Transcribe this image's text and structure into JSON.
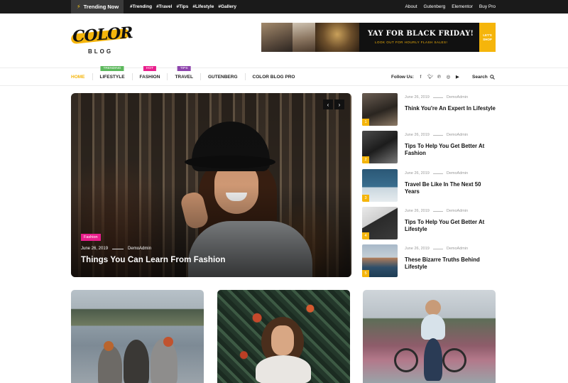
{
  "topbar": {
    "trending_label": "Trending Now",
    "tags": [
      "#Trending",
      "#Travel",
      "#Tips",
      "#Lifestyle",
      "#Gallery"
    ],
    "links": [
      "About",
      "Gutenberg",
      "Elementor",
      "Buy Pro"
    ]
  },
  "logo": {
    "word": "COLOR",
    "sub": "BLOG"
  },
  "banner": {
    "title": "YAY FOR BLACK FRIDAY!",
    "subtitle": "LOOK OUT FOR HOURLY FLASH SALES!",
    "cta": "LET'S SHOP"
  },
  "nav": {
    "items": [
      {
        "label": "HOME",
        "badge": ""
      },
      {
        "label": "LIFESTYLE",
        "badge": "TRENDING"
      },
      {
        "label": "FASHION",
        "badge": "HOT"
      },
      {
        "label": "TRAVEL",
        "badge": "TIPS"
      },
      {
        "label": "GUTENBERG",
        "badge": ""
      },
      {
        "label": "COLOR BLOG PRO",
        "badge": ""
      }
    ],
    "follow_label": "Follow Us:",
    "social_icons": [
      "facebook-icon",
      "twitter-icon",
      "pinterest-icon",
      "instagram-icon",
      "youtube-icon"
    ],
    "search_label": "Search"
  },
  "hero": {
    "category": "Fashion",
    "date": "June 26, 2019",
    "author": "DemoAdmin",
    "title": "Things You Can Learn From Fashion"
  },
  "side_posts": [
    {
      "num": "1",
      "date": "June 26, 2019",
      "author": "DemoAdmin",
      "title": "Think You're An Expert In Lifestyle"
    },
    {
      "num": "2",
      "date": "June 26, 2019",
      "author": "DemoAdmin",
      "title": "Tips To Help You Get Better At Fashion"
    },
    {
      "num": "3",
      "date": "June 26, 2019",
      "author": "DemoAdmin",
      "title": "Travel Be Like In The Next 50 Years"
    },
    {
      "num": "4",
      "date": "June 26, 2019",
      "author": "DemoAdmin",
      "title": "Tips To Help You Get Better At Lifestyle"
    },
    {
      "num": "5",
      "date": "June 26, 2019",
      "author": "DemoAdmin",
      "title": "These Bizarre Truths Behind Lifestyle"
    }
  ],
  "colors": {
    "accent": "#f5b50b",
    "hot": "#e91e8c",
    "trending": "#5cb85c",
    "tips": "#8e44ad",
    "topbar": "#1a1a1a"
  }
}
